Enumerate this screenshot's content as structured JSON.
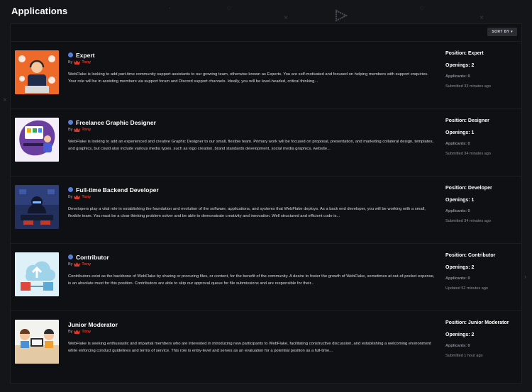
{
  "page": {
    "title": "Applications",
    "sort_label": "SORT BY"
  },
  "colors": {
    "background": "#141519",
    "panel": "#0f1013",
    "status_dot": "#5b7fd6",
    "author": "#e0362a"
  },
  "applications": [
    {
      "title": "Expert",
      "by": "By",
      "author": "Tony",
      "description": "WebFlake is looking to add part-time community support assistants to our growing team, otherwise known as Experts. You are self-motivated and focused on helping members with support enquiries. Your role will be in assisting members via support forum and Discord support channels. Ideally, you will be level-headed, critical thinking...",
      "position": "Position: Expert",
      "openings": "Openings: 2",
      "applicants": "Applicants: 0",
      "submitted": "Submitted 33 minutes ago",
      "has_dot": true,
      "thumbnail": "support-agent-illustration"
    },
    {
      "title": "Freelance Graphic Designer",
      "by": "By",
      "author": "Tony",
      "description": "WebFlake is looking to add an experienced and creative Graphic Designer to our small, flexible team. Primary work will be focused on proposal, presentation, and marketing collateral design, templates, and graphics, but could also include various media types, such as logo creation, brand standards development, social media graphics, website...",
      "position": "Position: Designer",
      "openings": "Openings: 1",
      "applicants": "Applicants: 0",
      "submitted": "Submitted 34 minutes ago",
      "has_dot": true,
      "thumbnail": "graphic-designer-illustration"
    },
    {
      "title": "Full-time Backend Developer",
      "by": "By",
      "author": "Tony",
      "description": "Developers play a vital role in establishing the foundation and evolution of the software, applications, and systems that WebFlake deploys. As a back end developer, you will be working with a small, flexible team. You must be a clear thinking problem solver and be able to demonstrate creativity and innovation. Well structured and efficient code is...",
      "position": "Position: Developer",
      "openings": "Openings: 1",
      "applicants": "Applicants: 0",
      "submitted": "Submitted 34 minutes ago",
      "has_dot": true,
      "thumbnail": "hacker-illustration"
    },
    {
      "title": "Contributor",
      "by": "By",
      "author": "Tony",
      "description": "Contributors exist as the backbone of WebFlake by sharing or procuring files, or content, for the benefit of the community.  A desire to foster the growth of WebFlake, sometimes at out-of-pocket expense, is an absolute must for this position. Contributors are able to skip our approval queue for file submissions and are responsible for their...",
      "position": "Position: Contributor",
      "openings": "Openings: 2",
      "applicants": "Applicants: 0",
      "submitted": "Updated 52 minutes ago",
      "has_dot": true,
      "thumbnail": "cloud-upload-illustration"
    },
    {
      "title": "Junior Moderator",
      "by": "By",
      "author": "Tony",
      "description": "WebFlake is seeking enthusiastic and impartial members who are interested in introducing new participants to WebFlake, facilitating constructive discussion, and establishing a welcoming environment while enforcing conduct guidelines and terms of service. This role is entry-level and serves as an evaluation for a potential position as a full-time...",
      "position": "Position: Junior Moderator",
      "openings": "Openings: 2",
      "applicants": "Applicants: 0",
      "submitted": "Submitted 1 hour ago",
      "has_dot": false,
      "thumbnail": "team-meeting-illustration"
    }
  ]
}
